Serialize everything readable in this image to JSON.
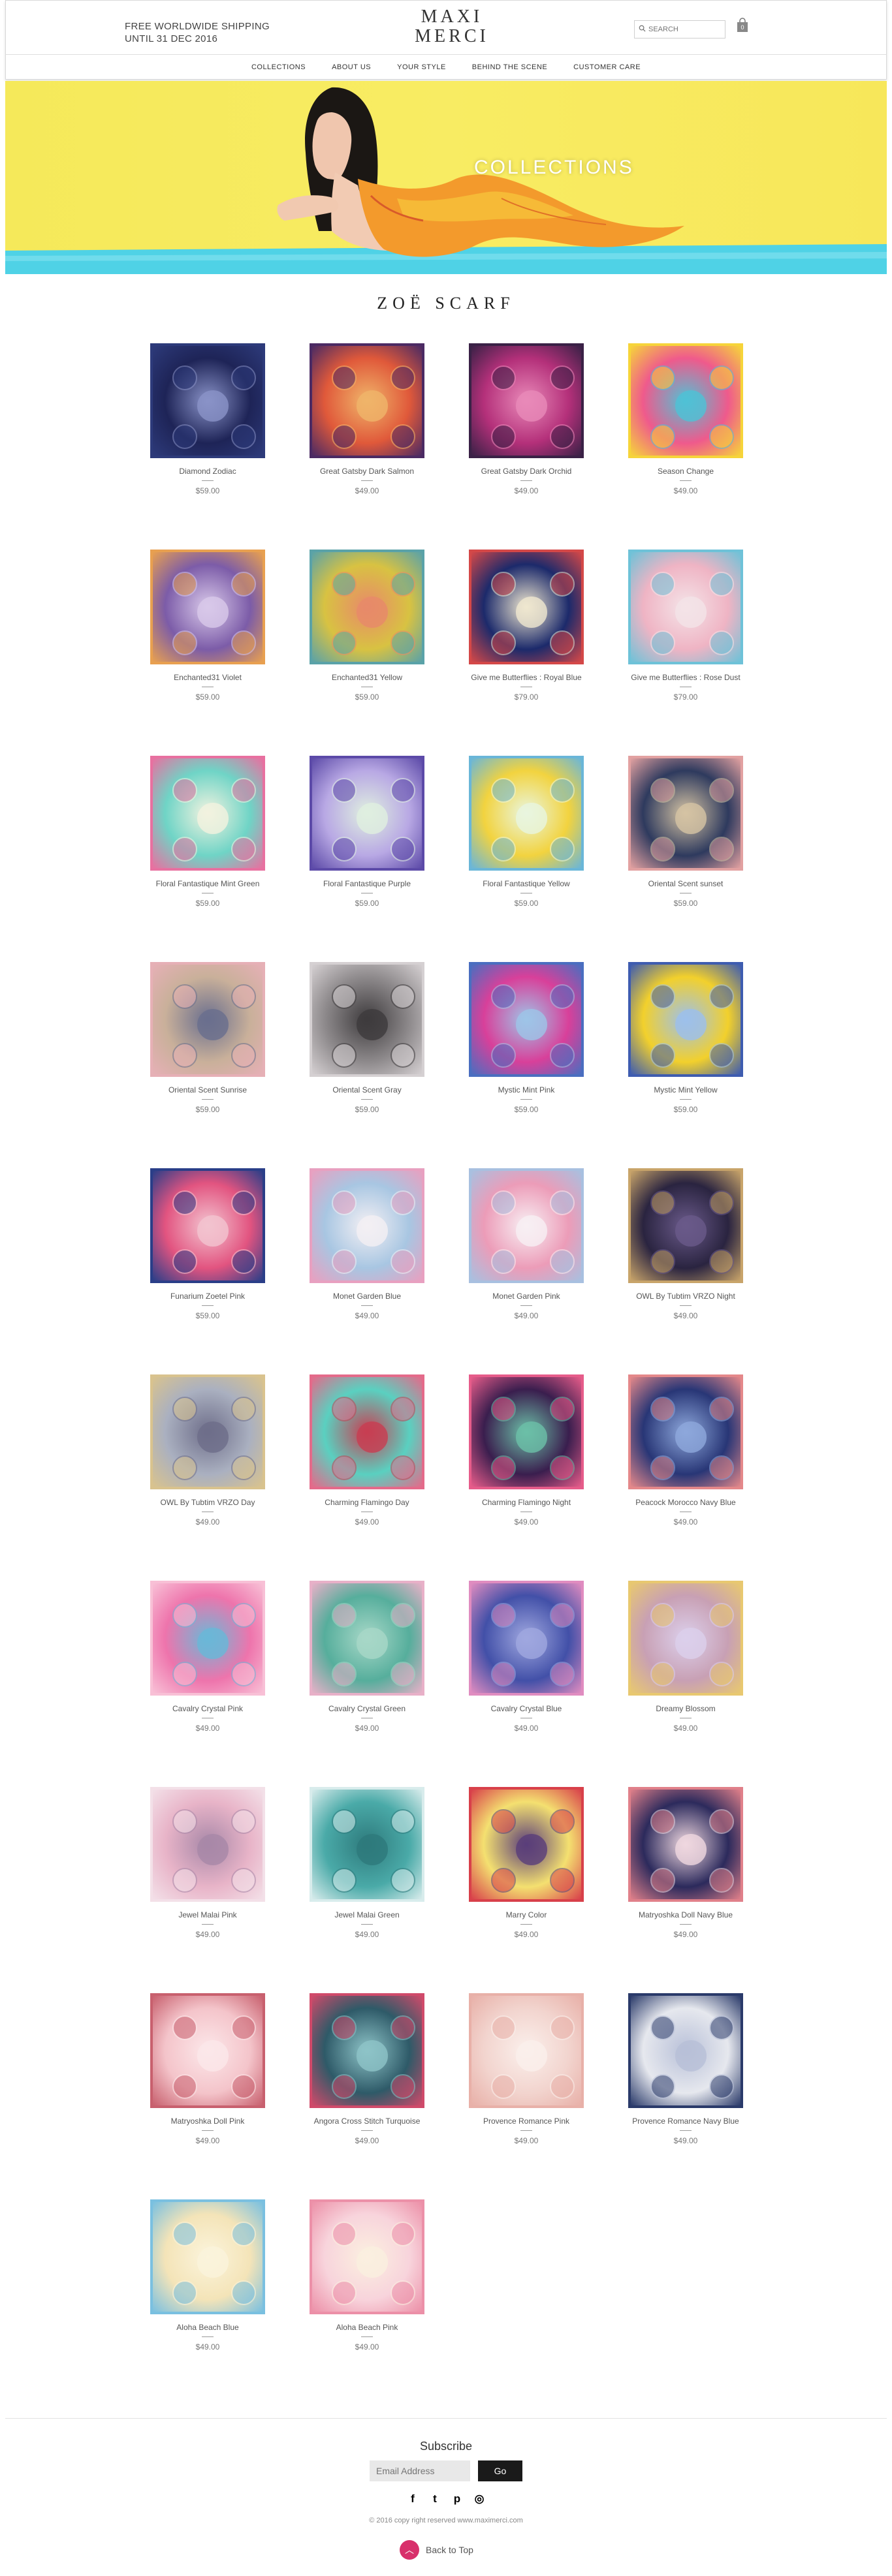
{
  "header": {
    "shipping_line1": "FREE WORLDWIDE SHIPPING",
    "shipping_line2": "UNTIL 31 DEC 2016",
    "logo_line1": "MAXI",
    "logo_line2": "MERCI",
    "search_placeholder": "SEARCH",
    "cart_count": "0",
    "nav": [
      "COLLECTIONS",
      "ABOUT US",
      "YOUR STYLE",
      "BEHIND THE SCENE",
      "CUSTOMER CARE"
    ]
  },
  "hero": {
    "title": "COLLECTIONS"
  },
  "section": {
    "title": "ZOË SCARF"
  },
  "products": [
    {
      "name": "Diamond Zodiac",
      "price": "$59.00",
      "colors": [
        "#1e2457",
        "#2d3a7a",
        "#8a93c8"
      ]
    },
    {
      "name": "Great Gatsby Dark Salmon",
      "price": "$49.00",
      "colors": [
        "#e0593a",
        "#4b2a63",
        "#f0b56a"
      ]
    },
    {
      "name": "Great Gatsby Dark Orchid",
      "price": "$49.00",
      "colors": [
        "#b4307a",
        "#3a2146",
        "#e98ab9"
      ]
    },
    {
      "name": "Season Change",
      "price": "$49.00",
      "colors": [
        "#ef5a8c",
        "#f6d43a",
        "#4fc2d6"
      ]
    },
    {
      "name": "Enchanted31 Violet",
      "price": "$59.00",
      "colors": [
        "#7c5ca8",
        "#e8a050",
        "#d9c9ea"
      ]
    },
    {
      "name": "Enchanted31 Yellow",
      "price": "$59.00",
      "colors": [
        "#d8c242",
        "#5aa2a8",
        "#e88a6a"
      ]
    },
    {
      "name": "Give me Butterflies : Royal Blue",
      "price": "$79.00",
      "colors": [
        "#1c2a6b",
        "#d44848",
        "#f0e8d0"
      ]
    },
    {
      "name": "Give me Butterflies : Rose Dust",
      "price": "$79.00",
      "colors": [
        "#efb4c4",
        "#6ec2d8",
        "#f4e4e8"
      ]
    },
    {
      "name": "Floral Fantastique Mint Green",
      "price": "$59.00",
      "colors": [
        "#6fd4c6",
        "#e870a0",
        "#f3f3e0"
      ]
    },
    {
      "name": "Floral Fantastique Purple",
      "price": "$59.00",
      "colors": [
        "#b8a8e4",
        "#5c4aa8",
        "#e0f0e0"
      ]
    },
    {
      "name": "Floral Fantastique Yellow",
      "price": "$59.00",
      "colors": [
        "#f2d33f",
        "#6ab6d8",
        "#e9f6e0"
      ]
    },
    {
      "name": "Oriental Scent sunset",
      "price": "$59.00",
      "colors": [
        "#2e3a5e",
        "#e2a1a1",
        "#d6c4a4"
      ]
    },
    {
      "name": "Oriental Scent Sunrise",
      "price": "$59.00",
      "colors": [
        "#c9b09a",
        "#e6b0b6",
        "#6a6f8e"
      ]
    },
    {
      "name": "Oriental Scent Gray",
      "price": "$59.00",
      "colors": [
        "#8e8a8c",
        "#d5d0d2",
        "#3e3b3d"
      ]
    },
    {
      "name": "Mystic Mint Pink",
      "price": "$59.00",
      "colors": [
        "#d8409a",
        "#4a6ec0",
        "#9ec5e8"
      ]
    },
    {
      "name": "Mystic Mint Yellow",
      "price": "$59.00",
      "colors": [
        "#f2d02c",
        "#3e5cb0",
        "#9dc0ec"
      ]
    },
    {
      "name": "Funarium Zoetel Pink",
      "price": "$59.00",
      "colors": [
        "#e25480",
        "#2a3e88",
        "#f3c4d0"
      ]
    },
    {
      "name": "Monet Garden Blue",
      "price": "$49.00",
      "colors": [
        "#a8c6e2",
        "#e8a0c0",
        "#f4f0f4"
      ]
    },
    {
      "name": "Monet Garden Pink",
      "price": "$49.00",
      "colors": [
        "#ec9cb8",
        "#a8c0e0",
        "#f8f0f4"
      ]
    },
    {
      "name": "OWL By Tubtim VRZO Night",
      "price": "$49.00",
      "colors": [
        "#2a2440",
        "#c8a46a",
        "#6a5a8a"
      ]
    },
    {
      "name": "OWL By Tubtim VRZO Day",
      "price": "$49.00",
      "colors": [
        "#aab0c0",
        "#d9c38e",
        "#6e6e8a"
      ]
    },
    {
      "name": "Charming Flamingo Day",
      "price": "$49.00",
      "colors": [
        "#5ad0c0",
        "#e46a8a",
        "#c83e52"
      ]
    },
    {
      "name": "Charming Flamingo Night",
      "price": "$49.00",
      "colors": [
        "#3a1e4e",
        "#e65c8a",
        "#6cc0a8"
      ]
    },
    {
      "name": "Peacock Morocco Navy Blue",
      "price": "$49.00",
      "colors": [
        "#283676",
        "#e4888a",
        "#8ea8dc"
      ]
    },
    {
      "name": "Cavalry Crystal Pink",
      "price": "$49.00",
      "colors": [
        "#ee74ac",
        "#f8c0d6",
        "#6ab8d8"
      ]
    },
    {
      "name": "Cavalry Crystal Green",
      "price": "$49.00",
      "colors": [
        "#56ae9c",
        "#e8b0c8",
        "#a8d8c8"
      ]
    },
    {
      "name": "Cavalry Crystal Blue",
      "price": "$49.00",
      "colors": [
        "#4250a8",
        "#e08cc0",
        "#a0a8e0"
      ]
    },
    {
      "name": "Dreamy Blossom",
      "price": "$49.00",
      "colors": [
        "#c8a0b4",
        "#e8c870",
        "#dcd0ec"
      ]
    },
    {
      "name": "Jewel Malai Pink",
      "price": "$49.00",
      "colors": [
        "#e8b4c8",
        "#f3e0e8",
        "#a888a8"
      ]
    },
    {
      "name": "Jewel Malai Green",
      "price": "$49.00",
      "colors": [
        "#4aaaa8",
        "#d8ecec",
        "#2e7a7c"
      ]
    },
    {
      "name": "Marry Color",
      "price": "$49.00",
      "colors": [
        "#f4e070",
        "#d8404a",
        "#5a3e7a"
      ]
    },
    {
      "name": "Matryoshka Doll Navy Blue",
      "price": "$49.00",
      "colors": [
        "#2c2a5c",
        "#e0808a",
        "#f0d8e0"
      ]
    },
    {
      "name": "Matryoshka Doll Pink",
      "price": "$49.00",
      "colors": [
        "#f4c4ca",
        "#c8606e",
        "#fce8ea"
      ]
    },
    {
      "name": "Angora Cross Stitch Turquoise",
      "price": "$49.00",
      "colors": [
        "#2e5a68",
        "#d04a6a",
        "#8ec4c8"
      ]
    },
    {
      "name": "Provence Romance Pink",
      "price": "$49.00",
      "colors": [
        "#f2d4ce",
        "#e8b0a8",
        "#fbf0ec"
      ]
    },
    {
      "name": "Provence Romance Navy Blue",
      "price": "$49.00",
      "colors": [
        "#e6e8ee",
        "#2a3a6a",
        "#b8c0d8"
      ]
    },
    {
      "name": "Aloha Beach Blue",
      "price": "$49.00",
      "colors": [
        "#f4e4b8",
        "#7ac0e0",
        "#fbf4dc"
      ]
    },
    {
      "name": "Aloha Beach Pink",
      "price": "$49.00",
      "colors": [
        "#f8d4dc",
        "#ec90a8",
        "#fbf0e0"
      ]
    }
  ],
  "footer": {
    "subscribe_title": "Subscribe",
    "email_placeholder": "Email Address",
    "go_label": "Go",
    "social": [
      "f",
      "t",
      "p",
      "◎"
    ],
    "copyright": "© 2016 copy right reserved www.maximerci.com",
    "back_to_top": "Back to Top"
  },
  "colors": {
    "accent_pink": "#d8306b",
    "hero_yellow": "#f5e95a"
  }
}
